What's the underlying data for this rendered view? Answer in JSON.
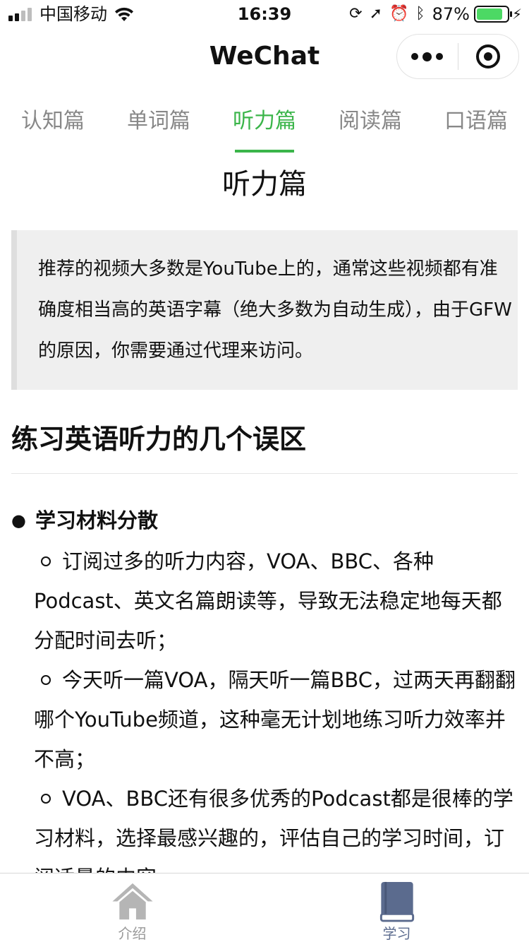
{
  "status_bar": {
    "carrier": "中国移动",
    "time": "16:39",
    "battery_percent": "87%",
    "battery_level": 0.87,
    "icons": [
      "signal-icon",
      "wifi-icon",
      "orientation-lock-icon",
      "location-icon",
      "alarm-icon",
      "bluetooth-icon",
      "battery-icon",
      "charging-icon"
    ]
  },
  "navbar": {
    "title": "WeChat",
    "capsule": [
      "more-icon",
      "close-miniprogram-icon"
    ]
  },
  "tabs": [
    {
      "label": "认知篇",
      "active": false
    },
    {
      "label": "单词篇",
      "active": false
    },
    {
      "label": "听力篇",
      "active": true
    },
    {
      "label": "阅读篇",
      "active": false
    },
    {
      "label": "口语篇",
      "active": false
    }
  ],
  "content": {
    "heading": "听力篇",
    "quote": "推荐的视频大多数是YouTube上的，通常这些视频都有准确度相当高的英语字幕（绝大多数为自动生成），由于GFW的原因，你需要通过代理来访问。",
    "section_title": "练习英语听力的几个误区",
    "list": [
      {
        "title": "学习材料分散",
        "items": [
          "订阅过多的听力内容，VOA、BBC、各种Podcast、英文名篇朗读等，导致无法稳定地每天都分配时间去听；",
          "今天听一篇VOA，隔天听一篇BBC，过两天再翻翻哪个YouTube频道，这种毫无计划地练习听力效率并不高；",
          "VOA、BBC还有很多优秀的Podcast都是很棒的学习材料，选择最感兴趣的，评估自己的学习时间，订阅适量的内容。"
        ]
      }
    ]
  },
  "tabbar": {
    "items": [
      {
        "label": "介绍",
        "icon": "home-icon",
        "active": false
      },
      {
        "label": "学习",
        "icon": "book-icon",
        "active": true
      }
    ],
    "colors": {
      "inactive": "#999999",
      "active": "#5b6b8e",
      "accent": "#3bb54a"
    }
  }
}
